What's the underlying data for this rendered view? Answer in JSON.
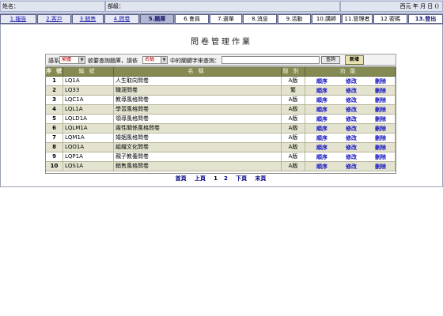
{
  "top_info": {
    "name_label": "姓名：",
    "dept_label": "部級：",
    "date_label": "西元 年 月 日 ()"
  },
  "nav_tabs": [
    {
      "label": "1.報告",
      "style": "link"
    },
    {
      "label": "2.客戶",
      "style": "link"
    },
    {
      "label": "3.銷售",
      "style": "link"
    },
    {
      "label": "4.問卷",
      "style": "link"
    },
    {
      "label": "5.題庫",
      "style": "active"
    },
    {
      "label": "6.會員",
      "style": "plain"
    },
    {
      "label": "7.選單",
      "style": "plain"
    },
    {
      "label": "8.消息",
      "style": "plain"
    },
    {
      "label": "9.活動",
      "style": "plain"
    },
    {
      "label": "10.講師",
      "style": "plain"
    },
    {
      "label": "11.管理者",
      "style": "plain"
    },
    {
      "label": "12.密碼",
      "style": "plain"
    },
    {
      "label": "13.登出",
      "style": "bold"
    }
  ],
  "page_title": "問卷管理作業",
  "search": {
    "prefix": "語系",
    "lang_value": "繁體",
    "mid_text": "欲要查詢題庫，請依",
    "field_value": "名稱",
    "suffix": "中的關鍵字來查詢：",
    "keyword_value": "",
    "search_button": "查詢",
    "add_button": "新增"
  },
  "table": {
    "headers": {
      "num": "序號",
      "code": "編號",
      "name": "名稱",
      "category": "版別",
      "actions": "功能"
    },
    "rows": [
      {
        "num": "1",
        "code": "LQ1A",
        "name": "人生取向問卷",
        "category": "A版",
        "actions": [
          "順序",
          "修改",
          "刪除"
        ]
      },
      {
        "num": "2",
        "code": "LQ33",
        "name": "職涯問卷",
        "category": "繁",
        "actions": [
          "順序",
          "修改",
          "刪除"
        ]
      },
      {
        "num": "3",
        "code": "LQC1A",
        "name": "教導風格問卷",
        "category": "A版",
        "actions": [
          "順序",
          "修改",
          "刪除"
        ]
      },
      {
        "num": "4",
        "code": "LQL1A",
        "name": "學習風格問卷",
        "category": "A版",
        "actions": [
          "順序",
          "修改",
          "刪除"
        ]
      },
      {
        "num": "5",
        "code": "LQLD1A",
        "name": "領導風格問卷",
        "category": "A版",
        "actions": [
          "順序",
          "修改",
          "刪除"
        ]
      },
      {
        "num": "6",
        "code": "LQLM1A",
        "name": "兩性關係風格問卷",
        "category": "A版",
        "actions": [
          "順序",
          "修改",
          "刪除"
        ]
      },
      {
        "num": "7",
        "code": "LQM1A",
        "name": "婚姻風格問卷",
        "category": "A版",
        "actions": [
          "順序",
          "修改",
          "刪除"
        ]
      },
      {
        "num": "8",
        "code": "LQO1A",
        "name": "組織文化問卷",
        "category": "A版",
        "actions": [
          "順序",
          "修改",
          "刪除"
        ]
      },
      {
        "num": "9",
        "code": "LQP1A",
        "name": "親子教養問卷",
        "category": "A版",
        "actions": [
          "順序",
          "修改",
          "刪除"
        ]
      },
      {
        "num": "10",
        "code": "LQS1A",
        "name": "銷售風格問卷",
        "category": "A版",
        "actions": [
          "順序",
          "修改",
          "刪除"
        ]
      }
    ]
  },
  "pager": {
    "first": "首頁",
    "prev": "上頁",
    "pages": [
      "1",
      "2"
    ],
    "current_page": "1",
    "next": "下頁",
    "last": "末頁"
  }
}
